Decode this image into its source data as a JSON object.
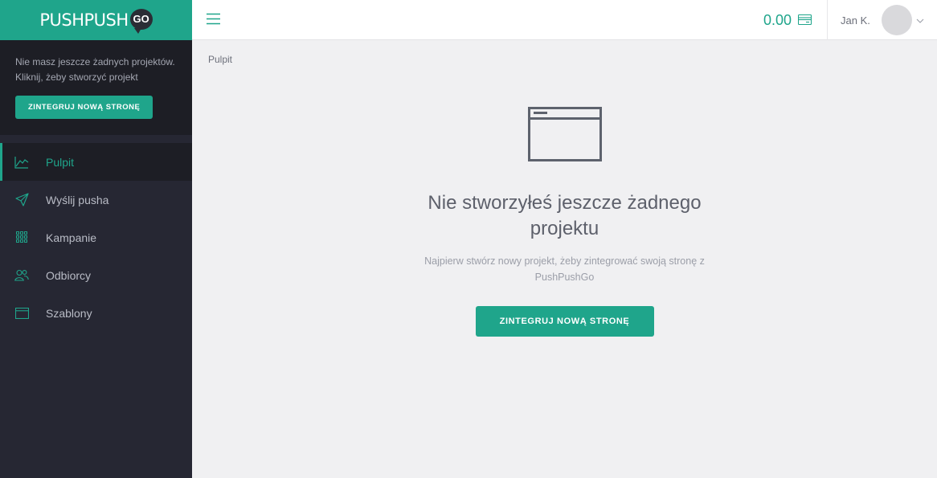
{
  "brand": {
    "name": "PUSHPUSH",
    "badge": "GO"
  },
  "promo": {
    "line1": "Nie masz jeszcze żadnych projektów.",
    "line2": "Kliknij, żeby stworzyć projekt",
    "button_label": "ZINTEGRUJ NOWĄ STRONĘ"
  },
  "sidebar": {
    "items": [
      {
        "label": "Pulpit",
        "icon": "chart-icon",
        "active": true
      },
      {
        "label": "Wyślij pusha",
        "icon": "paper-plane-icon"
      },
      {
        "label": "Kampanie",
        "icon": "grid-icon"
      },
      {
        "label": "Odbiorcy",
        "icon": "users-icon"
      },
      {
        "label": "Szablony",
        "icon": "template-icon"
      }
    ]
  },
  "topbar": {
    "balance": "0.00",
    "user_name": "Jan K."
  },
  "main": {
    "breadcrumb": "Pulpit",
    "empty_title": "Nie stworzyłeś jeszcze żadnego projektu",
    "empty_subtitle": "Najpierw stwórz nowy projekt, żeby zintegrować swoją stronę z PushPushGo",
    "cta_label": "ZINTEGRUJ NOWĄ STRONĘ"
  },
  "colors": {
    "accent": "#1fa58b",
    "sidebar_bg": "#262733",
    "sidebar_dark": "#1d1e25",
    "content_bg": "#f0f0f2"
  }
}
